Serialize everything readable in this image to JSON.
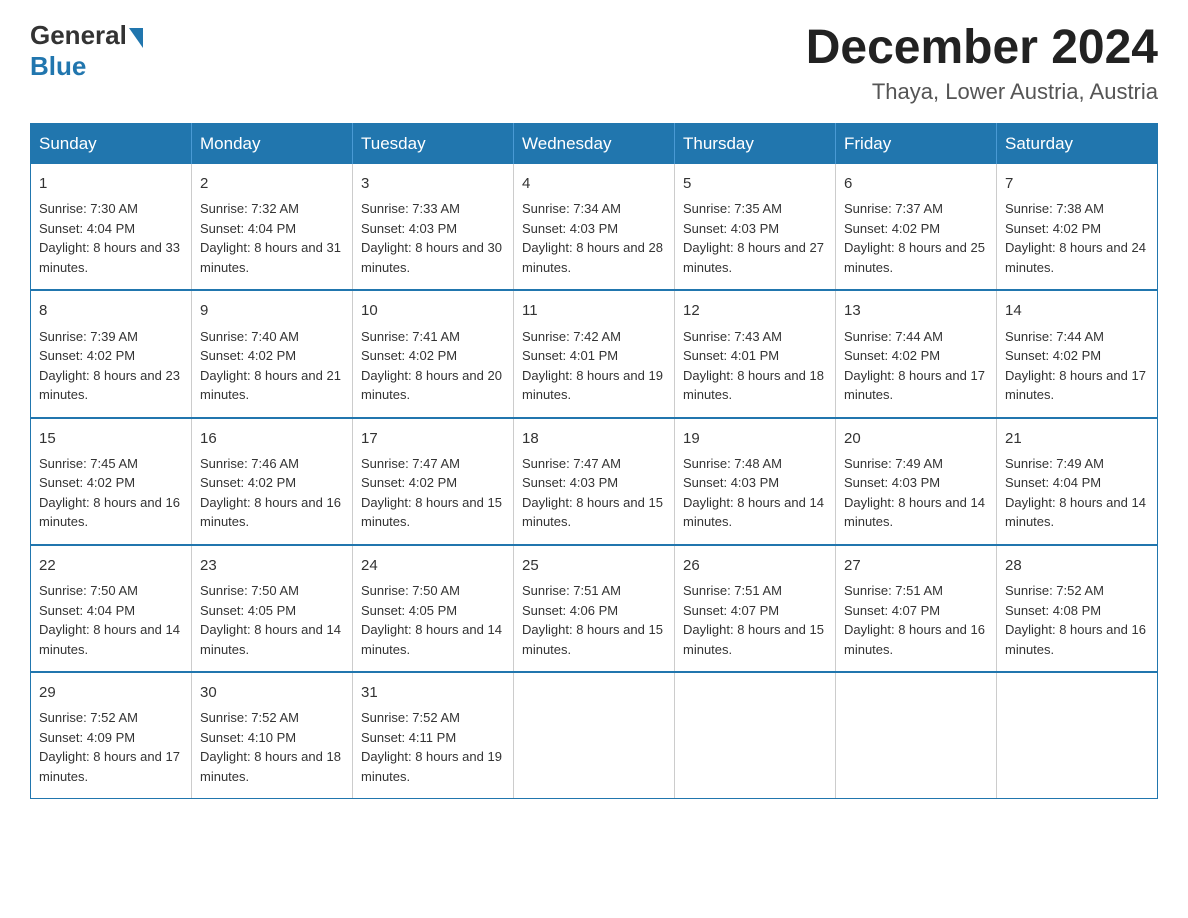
{
  "logo": {
    "general": "General",
    "blue": "Blue"
  },
  "header": {
    "month": "December 2024",
    "location": "Thaya, Lower Austria, Austria"
  },
  "weekdays": [
    "Sunday",
    "Monday",
    "Tuesday",
    "Wednesday",
    "Thursday",
    "Friday",
    "Saturday"
  ],
  "weeks": [
    [
      {
        "day": "1",
        "sunrise": "7:30 AM",
        "sunset": "4:04 PM",
        "daylight": "8 hours and 33 minutes."
      },
      {
        "day": "2",
        "sunrise": "7:32 AM",
        "sunset": "4:04 PM",
        "daylight": "8 hours and 31 minutes."
      },
      {
        "day": "3",
        "sunrise": "7:33 AM",
        "sunset": "4:03 PM",
        "daylight": "8 hours and 30 minutes."
      },
      {
        "day": "4",
        "sunrise": "7:34 AM",
        "sunset": "4:03 PM",
        "daylight": "8 hours and 28 minutes."
      },
      {
        "day": "5",
        "sunrise": "7:35 AM",
        "sunset": "4:03 PM",
        "daylight": "8 hours and 27 minutes."
      },
      {
        "day": "6",
        "sunrise": "7:37 AM",
        "sunset": "4:02 PM",
        "daylight": "8 hours and 25 minutes."
      },
      {
        "day": "7",
        "sunrise": "7:38 AM",
        "sunset": "4:02 PM",
        "daylight": "8 hours and 24 minutes."
      }
    ],
    [
      {
        "day": "8",
        "sunrise": "7:39 AM",
        "sunset": "4:02 PM",
        "daylight": "8 hours and 23 minutes."
      },
      {
        "day": "9",
        "sunrise": "7:40 AM",
        "sunset": "4:02 PM",
        "daylight": "8 hours and 21 minutes."
      },
      {
        "day": "10",
        "sunrise": "7:41 AM",
        "sunset": "4:02 PM",
        "daylight": "8 hours and 20 minutes."
      },
      {
        "day": "11",
        "sunrise": "7:42 AM",
        "sunset": "4:01 PM",
        "daylight": "8 hours and 19 minutes."
      },
      {
        "day": "12",
        "sunrise": "7:43 AM",
        "sunset": "4:01 PM",
        "daylight": "8 hours and 18 minutes."
      },
      {
        "day": "13",
        "sunrise": "7:44 AM",
        "sunset": "4:02 PM",
        "daylight": "8 hours and 17 minutes."
      },
      {
        "day": "14",
        "sunrise": "7:44 AM",
        "sunset": "4:02 PM",
        "daylight": "8 hours and 17 minutes."
      }
    ],
    [
      {
        "day": "15",
        "sunrise": "7:45 AM",
        "sunset": "4:02 PM",
        "daylight": "8 hours and 16 minutes."
      },
      {
        "day": "16",
        "sunrise": "7:46 AM",
        "sunset": "4:02 PM",
        "daylight": "8 hours and 16 minutes."
      },
      {
        "day": "17",
        "sunrise": "7:47 AM",
        "sunset": "4:02 PM",
        "daylight": "8 hours and 15 minutes."
      },
      {
        "day": "18",
        "sunrise": "7:47 AM",
        "sunset": "4:03 PM",
        "daylight": "8 hours and 15 minutes."
      },
      {
        "day": "19",
        "sunrise": "7:48 AM",
        "sunset": "4:03 PM",
        "daylight": "8 hours and 14 minutes."
      },
      {
        "day": "20",
        "sunrise": "7:49 AM",
        "sunset": "4:03 PM",
        "daylight": "8 hours and 14 minutes."
      },
      {
        "day": "21",
        "sunrise": "7:49 AM",
        "sunset": "4:04 PM",
        "daylight": "8 hours and 14 minutes."
      }
    ],
    [
      {
        "day": "22",
        "sunrise": "7:50 AM",
        "sunset": "4:04 PM",
        "daylight": "8 hours and 14 minutes."
      },
      {
        "day": "23",
        "sunrise": "7:50 AM",
        "sunset": "4:05 PM",
        "daylight": "8 hours and 14 minutes."
      },
      {
        "day": "24",
        "sunrise": "7:50 AM",
        "sunset": "4:05 PM",
        "daylight": "8 hours and 14 minutes."
      },
      {
        "day": "25",
        "sunrise": "7:51 AM",
        "sunset": "4:06 PM",
        "daylight": "8 hours and 15 minutes."
      },
      {
        "day": "26",
        "sunrise": "7:51 AM",
        "sunset": "4:07 PM",
        "daylight": "8 hours and 15 minutes."
      },
      {
        "day": "27",
        "sunrise": "7:51 AM",
        "sunset": "4:07 PM",
        "daylight": "8 hours and 16 minutes."
      },
      {
        "day": "28",
        "sunrise": "7:52 AM",
        "sunset": "4:08 PM",
        "daylight": "8 hours and 16 minutes."
      }
    ],
    [
      {
        "day": "29",
        "sunrise": "7:52 AM",
        "sunset": "4:09 PM",
        "daylight": "8 hours and 17 minutes."
      },
      {
        "day": "30",
        "sunrise": "7:52 AM",
        "sunset": "4:10 PM",
        "daylight": "8 hours and 18 minutes."
      },
      {
        "day": "31",
        "sunrise": "7:52 AM",
        "sunset": "4:11 PM",
        "daylight": "8 hours and 19 minutes."
      },
      null,
      null,
      null,
      null
    ]
  ]
}
